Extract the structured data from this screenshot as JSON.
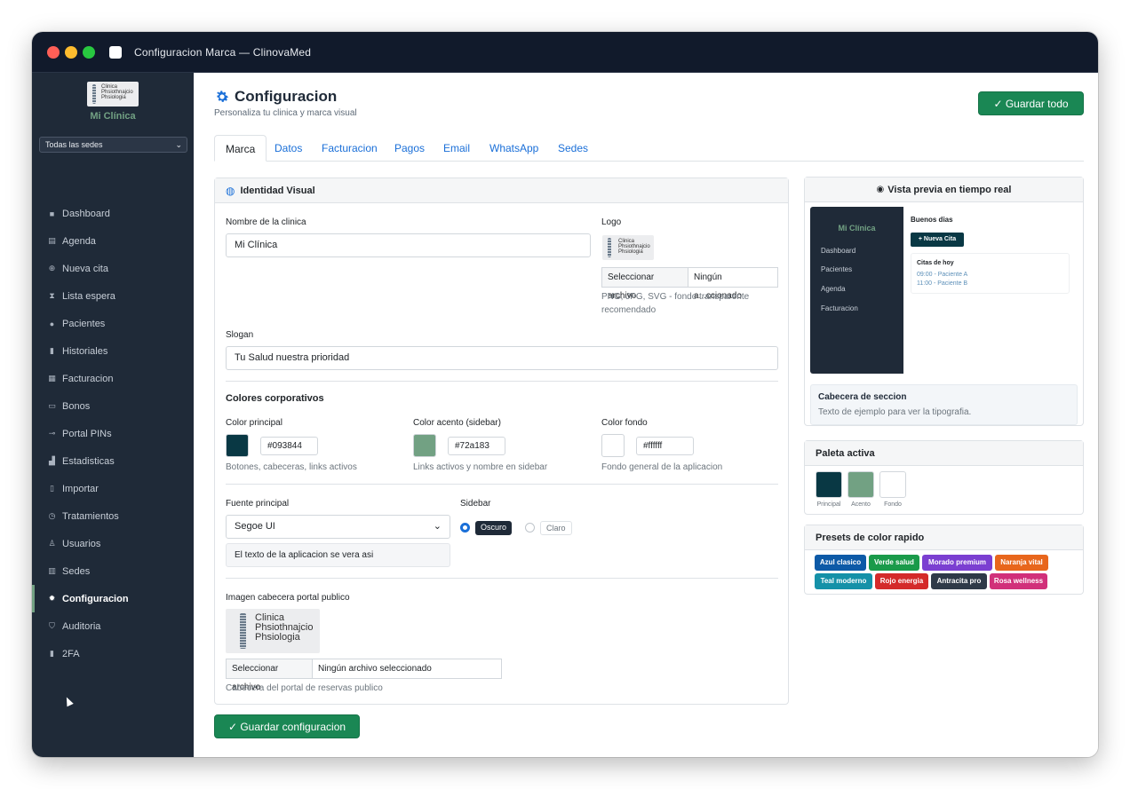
{
  "window": {
    "title": "Configuracion Marca  —  ClinovaMed"
  },
  "sidebar": {
    "logo_text": [
      "Clinica",
      "Phsiothnajcio",
      "Phsiologia"
    ],
    "brand_name": "Mi Clínica",
    "sede_select": "Todas las sedes",
    "active_color": "#72a183",
    "items": [
      {
        "label": "Dashboard",
        "icon": "home-icon"
      },
      {
        "label": "Agenda",
        "icon": "calendar-icon"
      },
      {
        "label": "Nueva cita",
        "icon": "plus-circle-icon"
      },
      {
        "label": "Lista espera",
        "icon": "hourglass-icon"
      },
      {
        "label": "Pacientes",
        "icon": "users-icon"
      },
      {
        "label": "Historiales",
        "icon": "file-icon"
      },
      {
        "label": "Facturacion",
        "icon": "invoice-icon"
      },
      {
        "label": "Bonos",
        "icon": "ticket-icon"
      },
      {
        "label": "Portal PINs",
        "icon": "key-icon"
      },
      {
        "label": "Estadisticas",
        "icon": "chart-icon"
      },
      {
        "label": "Importar",
        "icon": "import-icon"
      },
      {
        "label": "Tratamientos",
        "icon": "clock-icon"
      },
      {
        "label": "Usuarios",
        "icon": "user-gear-icon"
      },
      {
        "label": "Sedes",
        "icon": "building-icon"
      },
      {
        "label": "Configuracion",
        "icon": "gear-icon",
        "active": true
      },
      {
        "label": "Auditoria",
        "icon": "shield-icon"
      },
      {
        "label": "2FA",
        "icon": "phone-icon"
      }
    ]
  },
  "header": {
    "title": "Configuracion",
    "subtitle": "Personaliza tu clinica y marca visual",
    "save_all": "✓ Guardar todo"
  },
  "tabs": [
    "Marca",
    "Datos",
    "Facturacion",
    "Pagos",
    "Email",
    "WhatsApp",
    "Sedes"
  ],
  "identity": {
    "heading": "Identidad Visual",
    "clinic_name_label": "Nombre de la clinica",
    "clinic_name_value": "Mi Clínica",
    "logo_label": "Logo",
    "logo_file_button": "Seleccionar archivo",
    "logo_file_text": "Ningún a...ccionado",
    "logo_hint": "PNG, JPG, SVG - fondo transparente recomendado",
    "slogan_label": "Slogan",
    "slogan_value": "Tu Salud nuestra prioridad",
    "colors_title": "Colores corporativos",
    "color_primary_label": "Color principal",
    "color_primary": "#093844",
    "color_primary_hint": "Botones, cabeceras, links activos",
    "color_accent_label": "Color acento (sidebar)",
    "color_accent": "#72a183",
    "color_accent_hint": "Links activos y nombre en sidebar",
    "color_bg_label": "Color fondo",
    "color_bg": "#ffffff",
    "color_bg_hint": "Fondo general de la aplicacion",
    "font_label": "Fuente principal",
    "font_value": "Segoe UI",
    "font_preview": "El texto de la aplicacion se vera asi",
    "sidebar_label": "Sidebar",
    "sidebar_dark": "Oscuro",
    "sidebar_light": "Claro",
    "header_img_label": "Imagen cabecera portal publico",
    "header_file_button": "Seleccionar archivo",
    "header_file_text": "Ningún archivo seleccionado",
    "header_img_hint": "Cabecera del portal de reservas publico",
    "save_button": "✓ Guardar configuracion"
  },
  "preview": {
    "heading": "Vista previa en tiempo real",
    "brand": "Mi Clínica",
    "menu": [
      "Dashboard",
      "Pacientes",
      "Agenda",
      "Facturacion"
    ],
    "greeting": "Buenos dias",
    "new_button": "+ Nueva Cita",
    "card_title": "Citas de hoy",
    "card_items": [
      "09:00 - Paciente A",
      "11:00 - Paciente B"
    ],
    "section_title": "Cabecera de seccion",
    "section_text": "Texto de ejemplo para ver la tipografia."
  },
  "palette": {
    "heading": "Paleta activa",
    "items": [
      {
        "label": "Principal",
        "color": "#093844"
      },
      {
        "label": "Acento",
        "color": "#72a183"
      },
      {
        "label": "Fondo",
        "color": "#ffffff"
      }
    ]
  },
  "presets": {
    "heading": "Presets de color rapido",
    "items": [
      {
        "label": "Azul clasico",
        "color": "#0d5aa7"
      },
      {
        "label": "Verde salud",
        "color": "#1a9a4a"
      },
      {
        "label": "Morado premium",
        "color": "#7b3fd1"
      },
      {
        "label": "Naranja vital",
        "color": "#e8661c"
      },
      {
        "label": "Teal moderno",
        "color": "#1591a8"
      },
      {
        "label": "Rojo energia",
        "color": "#d42a2a"
      },
      {
        "label": "Antracita pro",
        "color": "#2f3a48"
      },
      {
        "label": "Rosa wellness",
        "color": "#d1307a"
      }
    ]
  }
}
